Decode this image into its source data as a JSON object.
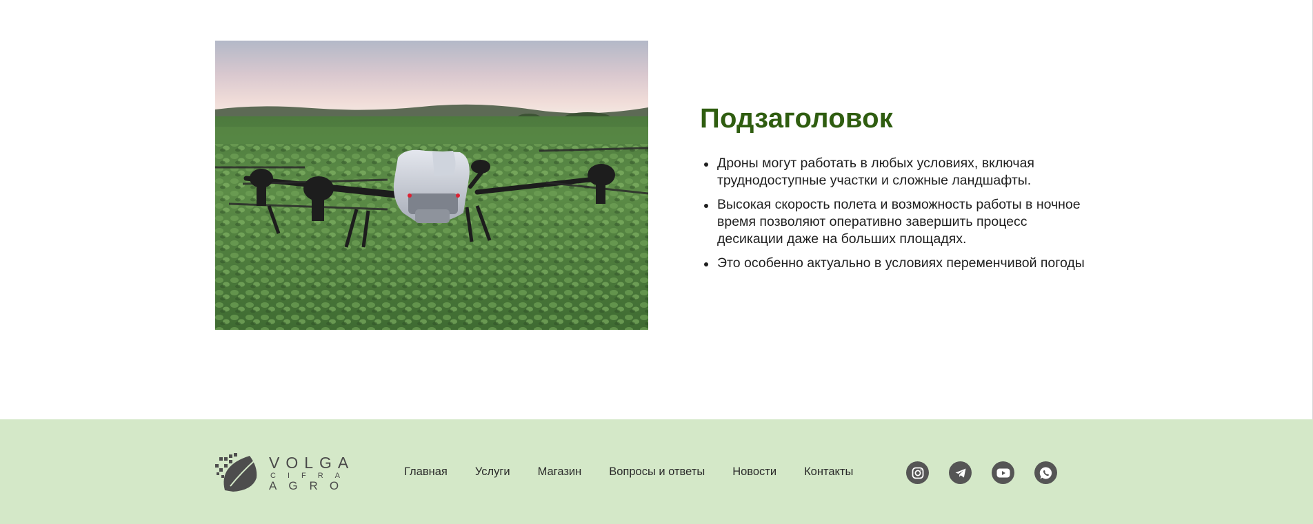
{
  "content": {
    "image_alt": "agricultural drone in a soybean field",
    "subheading": "Подзаголовок",
    "bullets": [
      "Дроны могут работать в любых условиях, включая труднодоступные участки и сложные ландшафты.",
      "Высокая скорость полета и возможность работы в ночное время позволяют оперативно завершить процесс десикации даже на больших площадях.",
      "Это особенно актуально в условиях переменчивой погоды"
    ]
  },
  "footer": {
    "logo": {
      "line1": "VOLGA",
      "line2": "CIFRA",
      "line3": "AGRO"
    },
    "nav": [
      "Главная",
      "Услуги",
      "Магазин",
      "Вопросы и ответы",
      "Новости",
      "Контакты"
    ],
    "social": [
      "instagram-icon",
      "telegram-icon",
      "youtube-icon",
      "whatsapp-icon"
    ]
  },
  "colors": {
    "heading": "#2f5d10",
    "footer_bg": "#d4e8c8",
    "icon_bg": "#555555"
  }
}
